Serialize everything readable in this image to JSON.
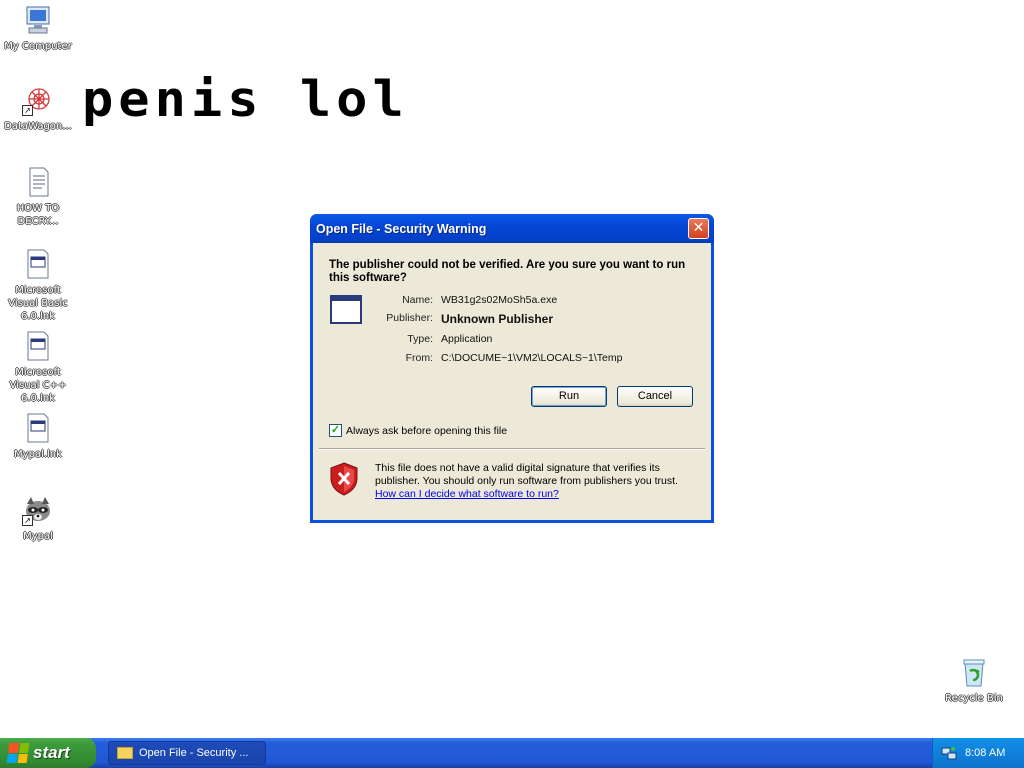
{
  "desktop": {
    "overlay_text": "penis lol",
    "icons": [
      {
        "label": "My Computer",
        "icon": "my-computer-icon"
      },
      {
        "label": "DataWagon...",
        "icon": "datawagon-icon"
      },
      {
        "label": "HOW TO DECRY...",
        "icon": "text-document-icon"
      },
      {
        "label": "Microsoft Visual Basic 6.0.lnk",
        "icon": "lnk-file-icon"
      },
      {
        "label": "Microsoft Visual C++ 6.0.lnk",
        "icon": "lnk-file-icon"
      },
      {
        "label": "Mypal.lnk",
        "icon": "lnk-file-icon"
      },
      {
        "label": "Mypal",
        "icon": "raccoon-icon"
      },
      {
        "label": "Recycle Bin",
        "icon": "recycle-bin-icon"
      }
    ]
  },
  "dialog": {
    "title": "Open File - Security Warning",
    "question": "The publisher could not be verified.  Are you sure you want to run this software?",
    "fields": {
      "name_label": "Name:",
      "name_value": "WB31g2s02MoSh5a.exe",
      "publisher_label": "Publisher:",
      "publisher_value": "Unknown Publisher",
      "type_label": "Type:",
      "type_value": "Application",
      "from_label": "From:",
      "from_value": "C:\\DOCUME~1\\VM2\\LOCALS~1\\Temp"
    },
    "run_label": "Run",
    "cancel_label": "Cancel",
    "checkbox_label": "Always ask before opening this file",
    "checkbox_checked": true,
    "warning_text": "This file does not have a valid digital signature that verifies its publisher.  You should only run software from publishers you trust.",
    "warning_link": "How can I decide what software to run?"
  },
  "taskbar": {
    "start_label": "start",
    "task_label": "Open File - Security ...",
    "clock": "8:08 AM"
  }
}
